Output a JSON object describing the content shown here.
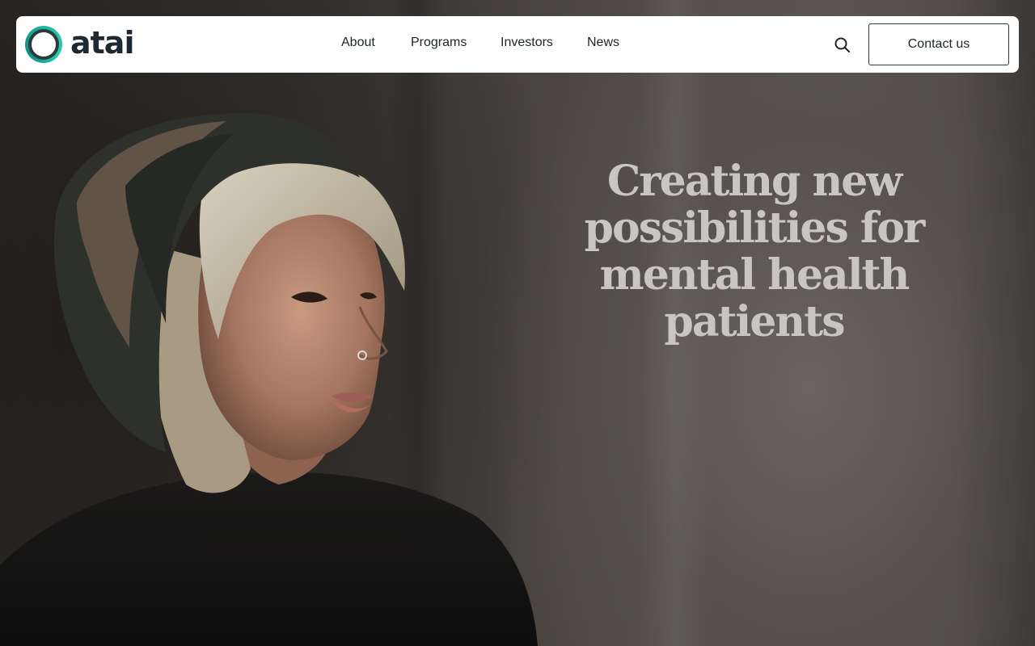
{
  "header": {
    "logo_text": "atai",
    "logo_colors": {
      "ring": "#1fb6a3",
      "ring_accent": "#26d0a8",
      "text": "#1e2a33"
    },
    "nav": [
      {
        "label": "About"
      },
      {
        "label": "Programs"
      },
      {
        "label": "Investors"
      },
      {
        "label": "News"
      }
    ],
    "search_icon": "search-icon",
    "contact_label": "Contact us"
  },
  "hero": {
    "headline": "Creating new possibilities for mental health patients",
    "image": "portrait-of-person-in-striped-beanie"
  }
}
